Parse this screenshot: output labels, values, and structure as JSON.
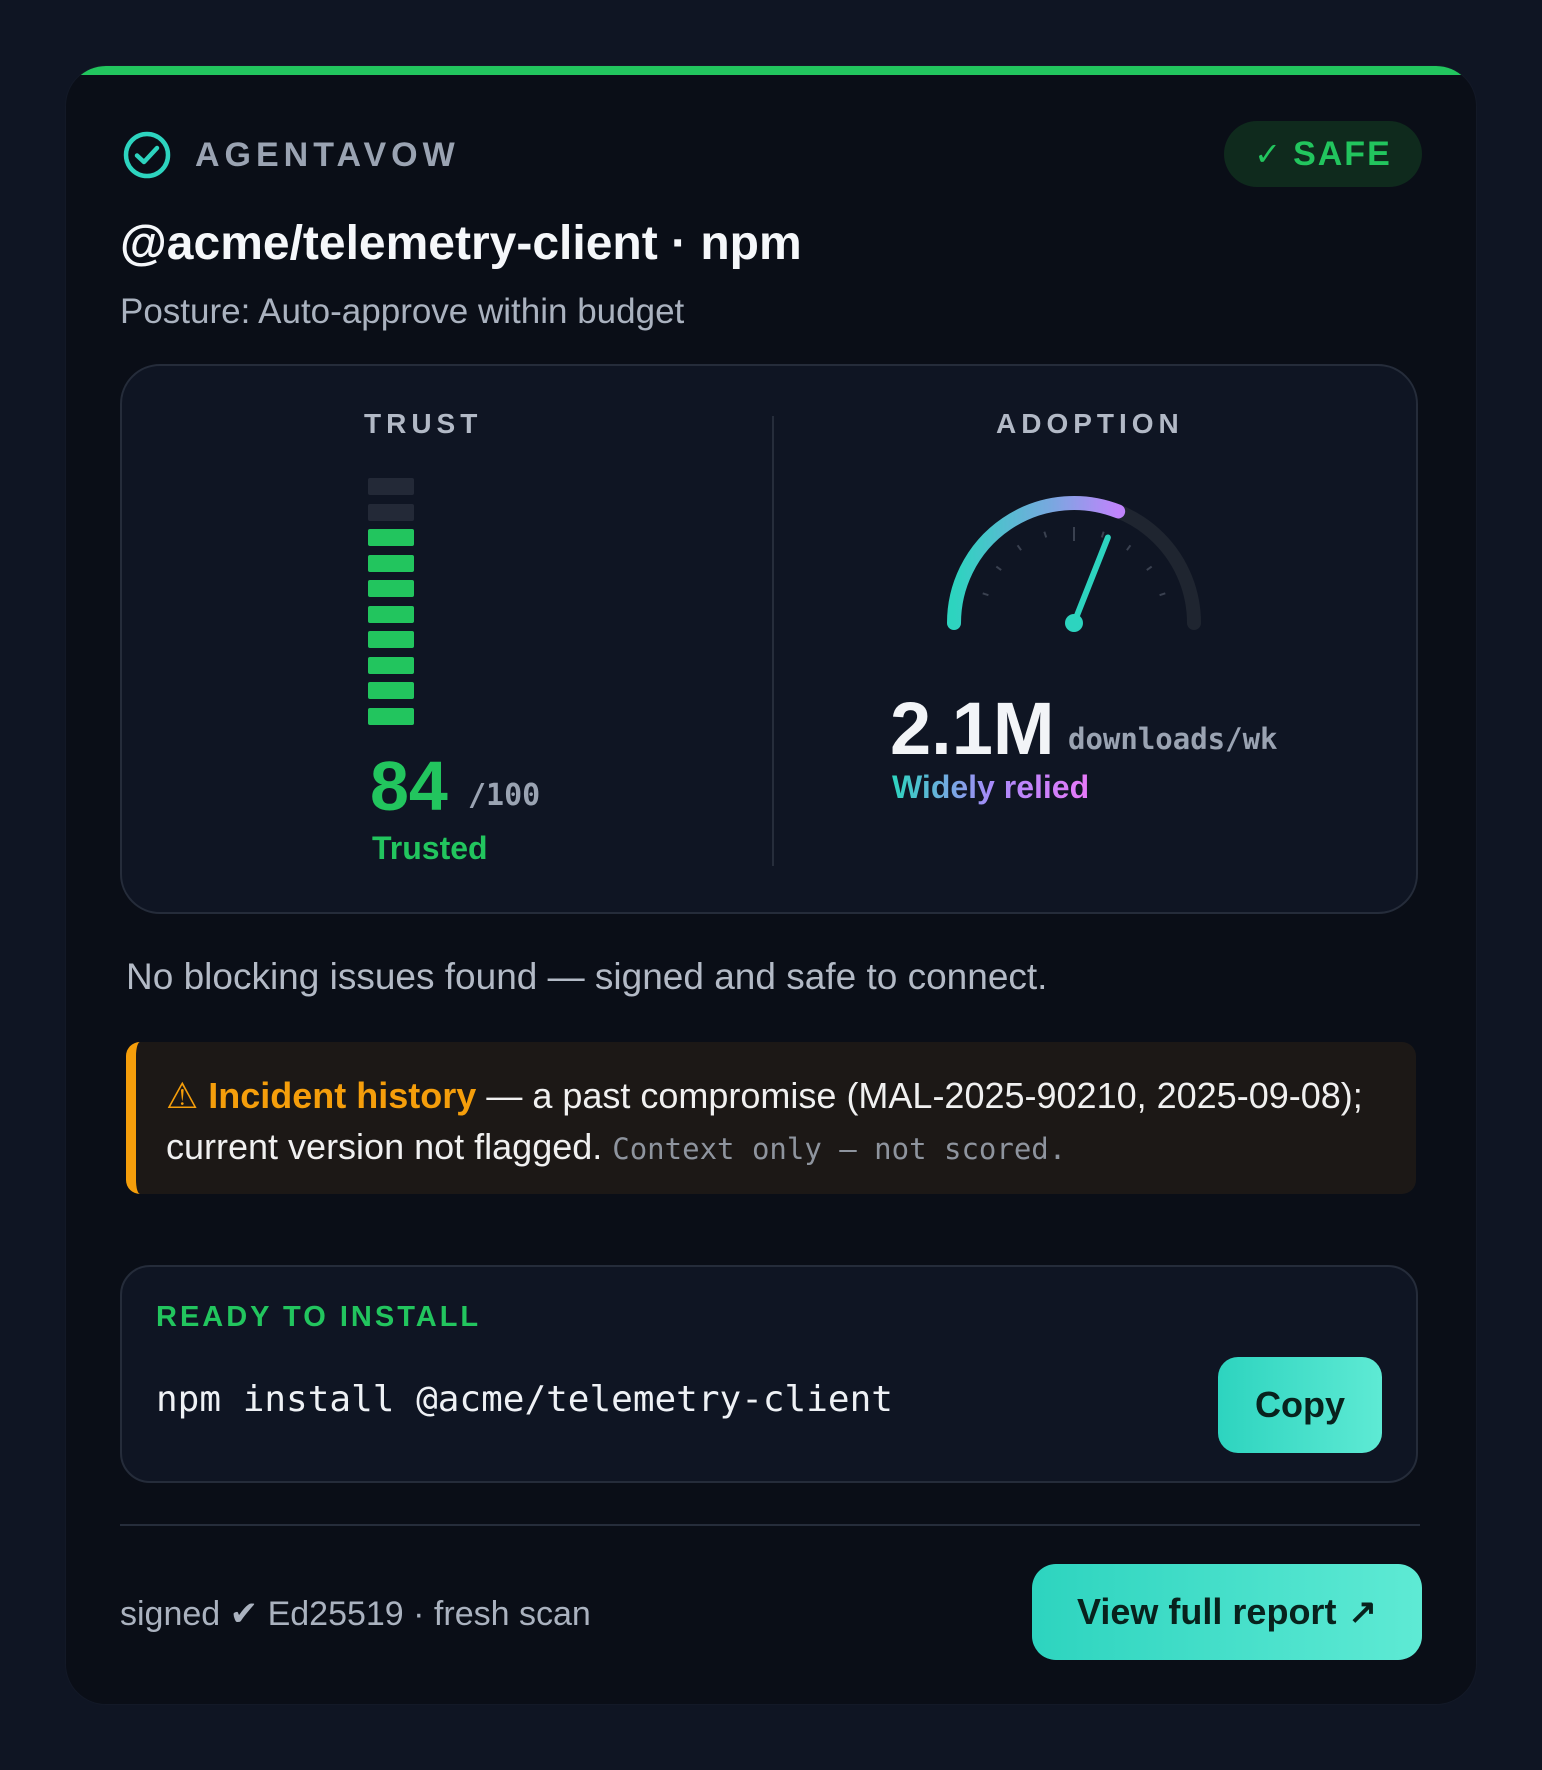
{
  "brand": {
    "name": "AGENTAVOW",
    "icon": "check-circle-icon",
    "color": "#2dd4bf"
  },
  "status": {
    "label": "SAFE",
    "icon": "checkmark-icon",
    "color": "#22c55e"
  },
  "package": {
    "title": "@acme/telemetry-client · npm",
    "posture": "Posture: Auto-approve within budget"
  },
  "metrics": {
    "trust": {
      "label": "TRUST",
      "score": "84",
      "max": "/100",
      "verdict": "Trusted",
      "segments_total": 10,
      "segments_filled": 8
    },
    "adoption": {
      "label": "ADOPTION",
      "value": "2.1M",
      "unit": "downloads/wk",
      "verdict": "Widely relied",
      "gauge_level": 0.62
    }
  },
  "summary": "No blocking issues found — signed and safe to connect.",
  "incident": {
    "icon": "warning-icon",
    "title": "Incident history",
    "body": " — a past compromise (MAL-2025-90210, 2025-09-08); current version not flagged. ",
    "note": "Context only — not scored."
  },
  "install": {
    "label": "READY TO INSTALL",
    "command": "npm install @acme/telemetry-client",
    "copy_label": "Copy"
  },
  "footer": {
    "signed": "signed ✔ Ed25519 · fresh scan",
    "report_label": "View full report",
    "report_icon": "external-arrow-icon"
  }
}
